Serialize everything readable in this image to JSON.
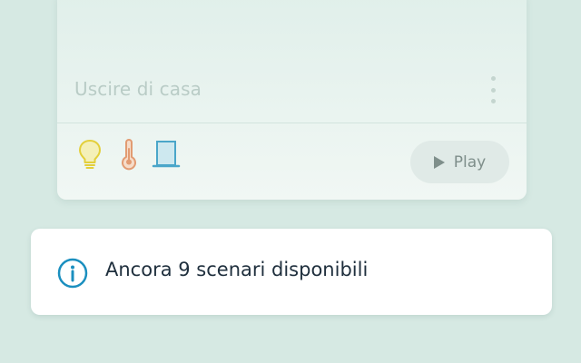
{
  "scenario": {
    "title": "Uscire di casa",
    "menu_icon": "more-vertical-icon",
    "devices": [
      {
        "icon": "lightbulb-icon",
        "color": "#e3cf3a"
      },
      {
        "icon": "thermometer-icon",
        "color": "#e29b72"
      },
      {
        "icon": "window-blind-icon",
        "color": "#4aa6c9"
      }
    ],
    "play_button": {
      "label": "Play",
      "icon": "play-icon"
    }
  },
  "info_banner": {
    "icon": "info-icon",
    "icon_color": "#1b8fbf",
    "text": "Ancora 9 scenari disponibili"
  },
  "colors": {
    "background": "#d6e9e3",
    "banner_background": "#ffffff",
    "text_primary": "#1f2f3d"
  }
}
